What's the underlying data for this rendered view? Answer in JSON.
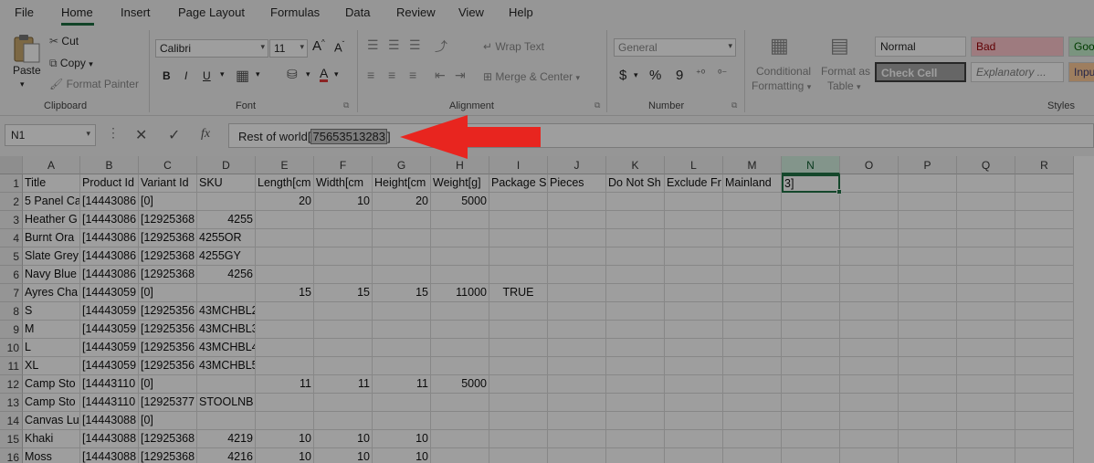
{
  "menu": {
    "items": [
      "File",
      "Home",
      "Insert",
      "Page Layout",
      "Formulas",
      "Data",
      "Review",
      "View",
      "Help"
    ],
    "active": "Home"
  },
  "ribbon": {
    "clipboard": {
      "paste": "Paste",
      "cut": "Cut",
      "copy": "Copy",
      "format_painter": "Format Painter",
      "group_label": "Clipboard"
    },
    "font": {
      "family": "Calibri",
      "size": "11",
      "grow": "A",
      "shrink": "A",
      "bold": "B",
      "italic": "I",
      "underline": "U",
      "font_color": "A",
      "group_label": "Font"
    },
    "alignment": {
      "wrap_text": "Wrap Text",
      "merge_center": "Merge & Center",
      "group_label": "Alignment"
    },
    "number": {
      "format": "General",
      "currency": "$",
      "percent": "%",
      "comma": "9",
      "group_label": "Number"
    },
    "styles": {
      "conditional_formatting_line1": "Conditional",
      "conditional_formatting_line2": "Formatting",
      "format_as_table_line1": "Format as",
      "format_as_table_line2": "Table",
      "normal": "Normal",
      "bad": "Bad",
      "good": "Goo",
      "check_cell": "Check Cell",
      "explanatory": "Explanatory ...",
      "input": "Inpu",
      "group_label": "Styles"
    }
  },
  "formula_bar": {
    "name_box": "N1",
    "fx": "fx",
    "content_before": "Rest of world[",
    "content_selected": "75653513283",
    "content_after": "]"
  },
  "grid": {
    "columns": [
      "A",
      "B",
      "C",
      "D",
      "E",
      "F",
      "G",
      "H",
      "I",
      "J",
      "K",
      "L",
      "M",
      "N",
      "O",
      "P",
      "Q",
      "R"
    ],
    "selected_column": "N",
    "rows": [
      "1",
      "2",
      "3",
      "4",
      "5",
      "6",
      "7",
      "8",
      "9",
      "10",
      "11",
      "12",
      "13",
      "14",
      "15",
      "16"
    ],
    "cells": [
      [
        "Title",
        "Product Id",
        "Variant Id",
        "SKU",
        "Length[cm",
        "Width[cm",
        "Height[cm",
        "Weight[g]",
        "Package S",
        "Pieces",
        "Do Not Sh",
        "Exclude Fr",
        "Mainland",
        "3]"
      ],
      [
        "5 Panel Ca",
        "[14443086",
        "[0]",
        "",
        "20",
        "10",
        "20",
        "5000",
        "",
        "",
        "",
        "",
        "",
        ""
      ],
      [
        "Heather G",
        "[14443086",
        "[12925368",
        "4255",
        "",
        "",
        "",
        "",
        "",
        "",
        "",
        "",
        "",
        ""
      ],
      [
        "Burnt Ora",
        "[14443086",
        "[12925368",
        "4255OR",
        "",
        "",
        "",
        "",
        "",
        "",
        "",
        "",
        "",
        ""
      ],
      [
        "Slate Grey",
        "[14443086",
        "[12925368",
        "4255GY",
        "",
        "",
        "",
        "",
        "",
        "",
        "",
        "",
        "",
        ""
      ],
      [
        "Navy Blue",
        "[14443086",
        "[12925368",
        "4256",
        "",
        "",
        "",
        "",
        "",
        "",
        "",
        "",
        "",
        ""
      ],
      [
        "Ayres Cha",
        "[14443059",
        "[0]",
        "",
        "15",
        "15",
        "15",
        "11000",
        "TRUE",
        "",
        "",
        "",
        "",
        ""
      ],
      [
        "S",
        "[14443059",
        "[12925356",
        "43MCHBL2",
        "",
        "",
        "",
        "",
        "",
        "",
        "",
        "",
        "",
        ""
      ],
      [
        "M",
        "[14443059",
        "[12925356",
        "43MCHBL3",
        "",
        "",
        "",
        "",
        "",
        "",
        "",
        "",
        "",
        ""
      ],
      [
        "L",
        "[14443059",
        "[12925356",
        "43MCHBL4",
        "",
        "",
        "",
        "",
        "",
        "",
        "",
        "",
        "",
        ""
      ],
      [
        "XL",
        "[14443059",
        "[12925356",
        "43MCHBL5",
        "",
        "",
        "",
        "",
        "",
        "",
        "",
        "",
        "",
        ""
      ],
      [
        "Camp Sto",
        "[14443110",
        "[0]",
        "",
        "11",
        "11",
        "11",
        "5000",
        "",
        "",
        "",
        "",
        "",
        ""
      ],
      [
        "Camp Sto",
        "[14443110",
        "[12925377",
        "STOOLNB",
        "",
        "",
        "",
        "",
        "",
        "",
        "",
        "",
        "",
        ""
      ],
      [
        "Canvas Lu",
        "[14443088",
        "[0]",
        "",
        "",
        "",
        "",
        "",
        "",
        "",
        "",
        "",
        "",
        ""
      ],
      [
        "Khaki",
        "[14443088",
        "[12925368",
        "4219",
        "10",
        "10",
        "10",
        "",
        "",
        "",
        "",
        "",
        "",
        ""
      ],
      [
        "Moss",
        "[14443088",
        "[12925368",
        "4216",
        "10",
        "10",
        "10",
        "",
        "",
        "",
        "",
        "",
        "",
        ""
      ]
    ],
    "active_cell": "N1"
  },
  "colors": {
    "accent": "#217346",
    "arrow": "#e8251f"
  }
}
